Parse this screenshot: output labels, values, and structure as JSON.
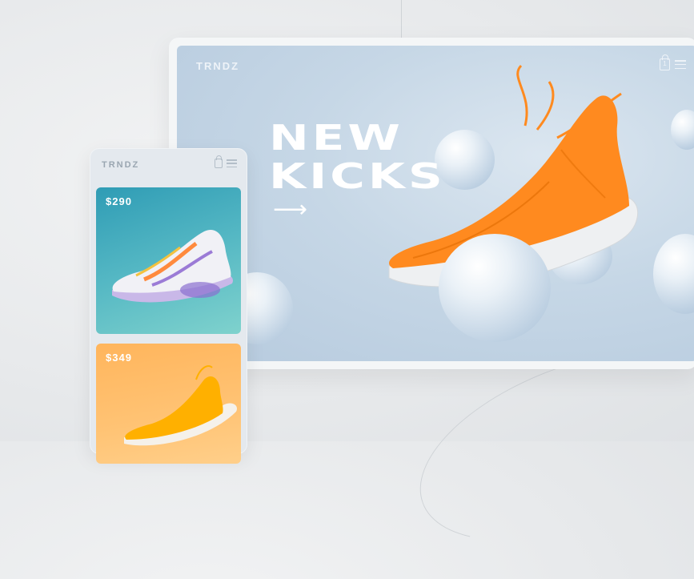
{
  "desktop": {
    "brand": "TRNDZ",
    "cart_count": "1",
    "headline_line1": "NEW",
    "headline_line2": "KICKS",
    "arrow": "⟶"
  },
  "mobile": {
    "brand": "TRNDZ",
    "products": [
      {
        "price": "$290"
      },
      {
        "price": "$349"
      }
    ]
  },
  "colors": {
    "accent_orange": "#ff8a1f",
    "card_teal": "#3aa6b8",
    "card_orange": "#ffb55c"
  }
}
